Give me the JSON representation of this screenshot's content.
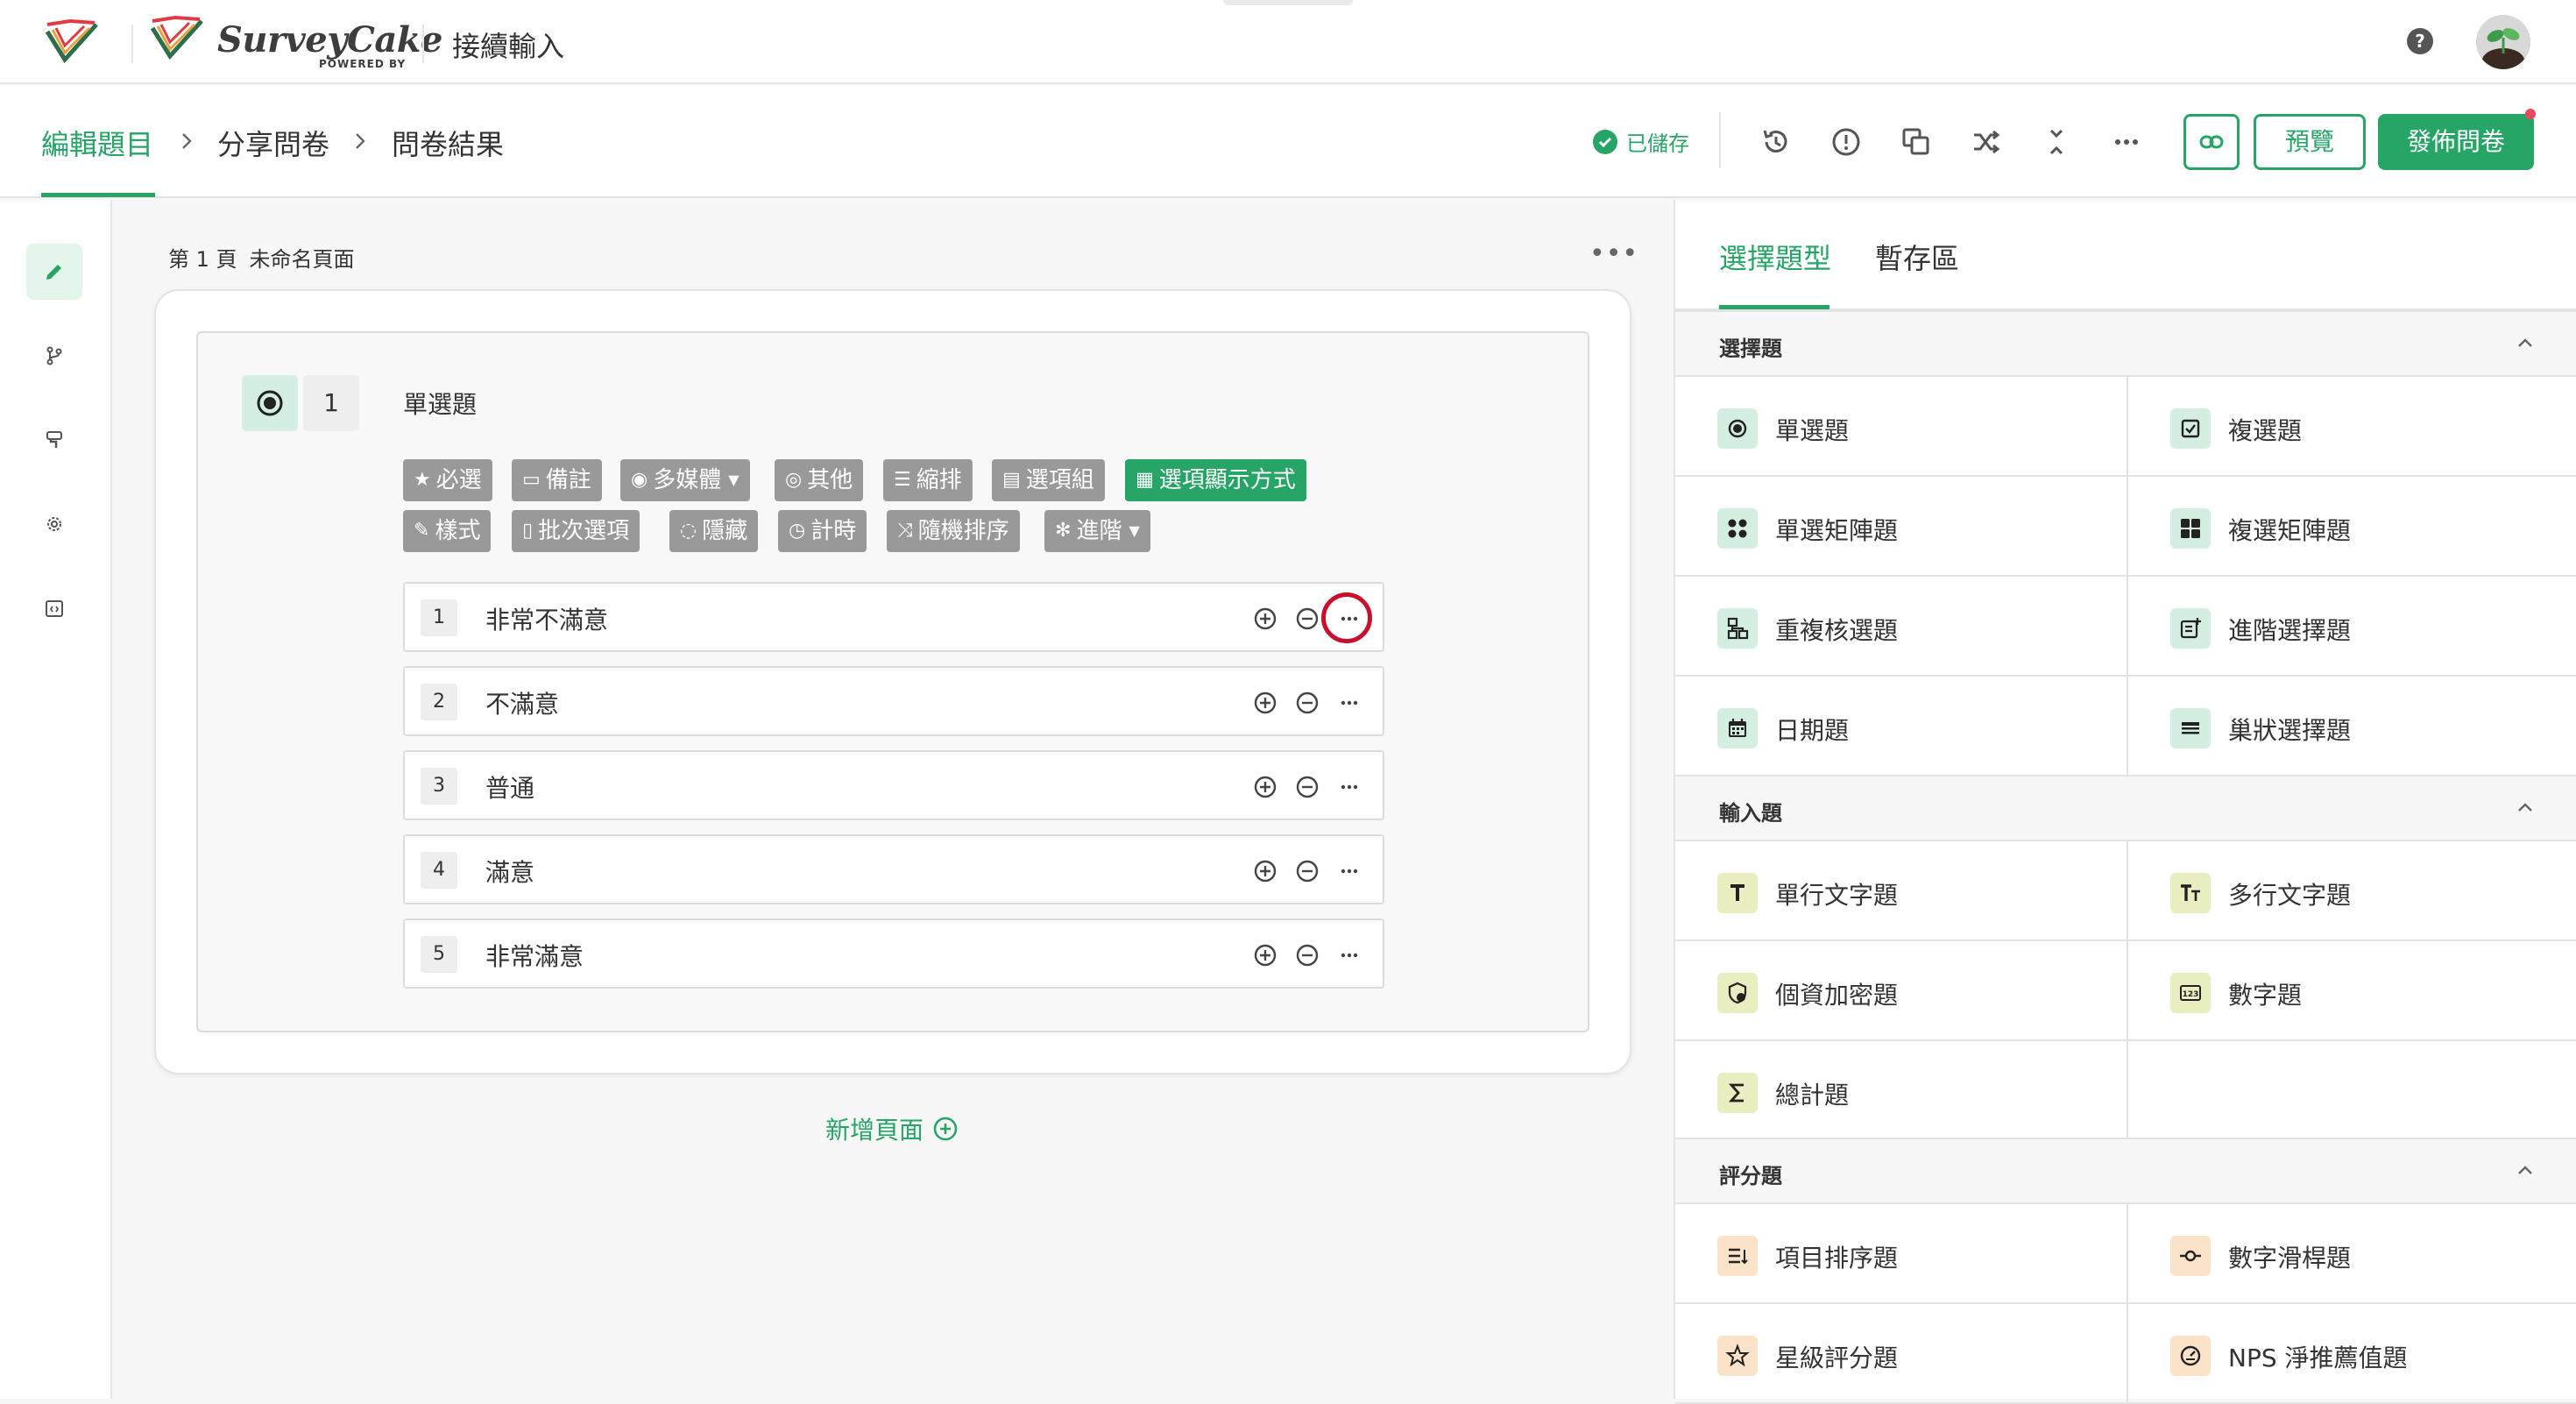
{
  "header": {
    "brand": "SurveyCake",
    "brand_sub": "POWERED BY",
    "doc_title": "接續輸入",
    "help": "?"
  },
  "steps": [
    "編輯題目",
    "分享問卷",
    "問卷結果"
  ],
  "toolbar": {
    "saved": "已儲存",
    "preview": "預覽",
    "publish": "發佈問卷"
  },
  "page": {
    "number": "第 1 頁",
    "name": "未命名頁面",
    "add_page": "新增頁面"
  },
  "question": {
    "number": "1",
    "title": "單選題",
    "chips_row1": [
      {
        "label": "必選",
        "icon": "star-icon"
      },
      {
        "label": "備註",
        "icon": "comment-icon"
      },
      {
        "label": "多媒體",
        "icon": "camera-icon",
        "dropdown": true
      },
      {
        "label": "其他",
        "icon": "radio-icon"
      },
      {
        "label": "縮排",
        "icon": "indent-icon"
      },
      {
        "label": "選項組",
        "icon": "list-icon"
      },
      {
        "label": "選項顯示方式",
        "icon": "grid-icon",
        "active": true
      }
    ],
    "chips_row2": [
      {
        "label": "樣式",
        "icon": "brush-icon"
      },
      {
        "label": "批次選項",
        "icon": "doc-icon"
      },
      {
        "label": "隱藏",
        "icon": "eye-off-icon"
      },
      {
        "label": "計時",
        "icon": "clock-icon"
      },
      {
        "label": "隨機排序",
        "icon": "shuffle-icon"
      },
      {
        "label": "進階",
        "icon": "gear-icon",
        "dropdown": true
      }
    ],
    "options": [
      {
        "n": "1",
        "text": "非常不滿意"
      },
      {
        "n": "2",
        "text": "不滿意"
      },
      {
        "n": "3",
        "text": "普通"
      },
      {
        "n": "4",
        "text": "滿意"
      },
      {
        "n": "5",
        "text": "非常滿意"
      }
    ]
  },
  "right_panel": {
    "tabs": [
      "選擇題型",
      "暫存區"
    ],
    "sections": [
      {
        "title": "選擇題",
        "items": [
          "單選題",
          "複選題",
          "單選矩陣題",
          "複選矩陣題",
          "重複核選題",
          "進階選擇題",
          "日期題",
          "巢狀選擇題"
        ]
      },
      {
        "title": "輸入題",
        "items": [
          "單行文字題",
          "多行文字題",
          "個資加密題",
          "數字題",
          "總計題"
        ]
      },
      {
        "title": "評分題",
        "items": [
          "項目排序題",
          "數字滑桿題",
          "星級評分題",
          "NPS 淨推薦值題"
        ]
      }
    ]
  },
  "colors": {
    "accent": "#27a566",
    "chip_gray": "#999999",
    "highlight": "#c8102e"
  }
}
